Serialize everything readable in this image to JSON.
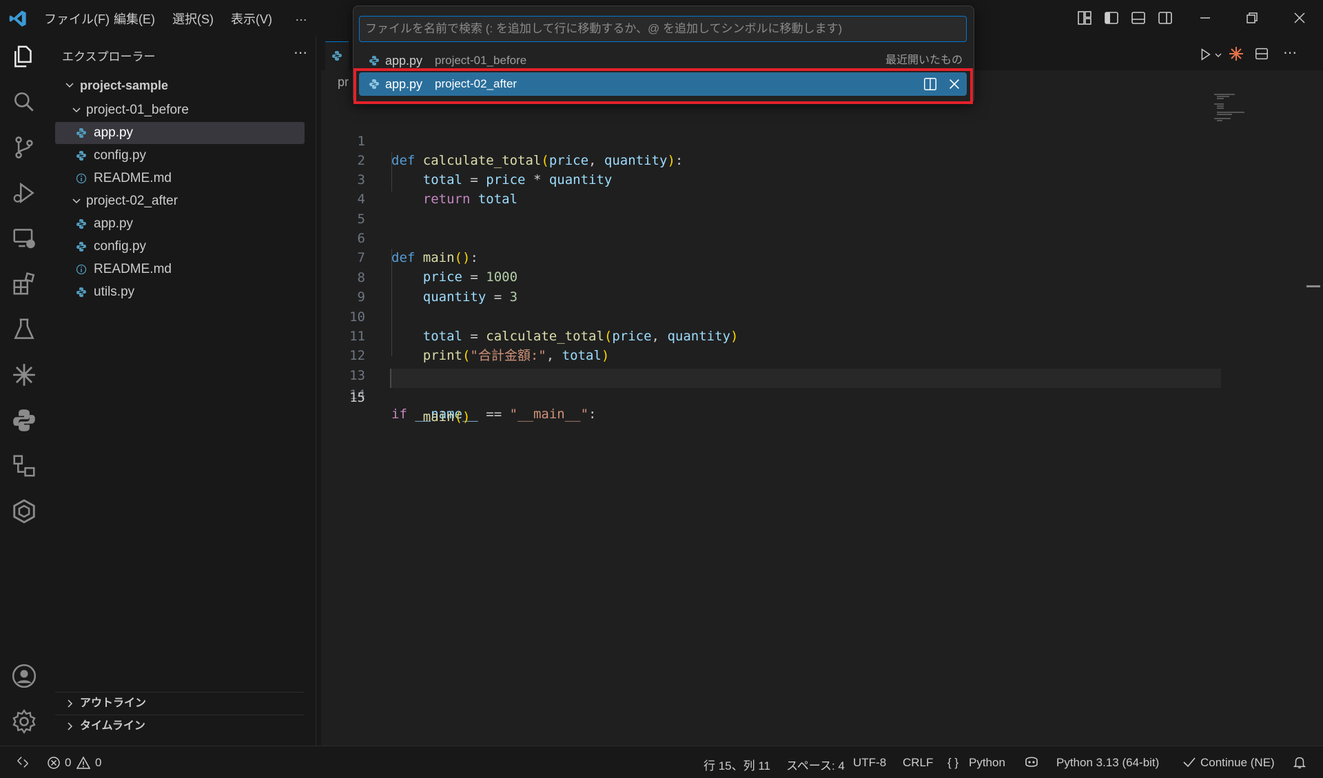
{
  "menu": [
    "ファイル(F)",
    "編集(E)",
    "選択(S)",
    "表示(V)",
    "…"
  ],
  "quickopen": {
    "placeholder": "ファイルを名前で検索 (: を追加して行に移動するか、@ を追加してシンボルに移動します)",
    "items": [
      {
        "name": "app.py",
        "desc": "project-01_before",
        "tag": "最近開いたもの"
      },
      {
        "name": "app.py",
        "desc": "project-02_after"
      }
    ]
  },
  "sidebar": {
    "title": "エクスプローラー",
    "root": "project-sample",
    "folder1": "project-01_before",
    "folder1_files": [
      "app.py",
      "config.py",
      "README.md"
    ],
    "folder2": "project-02_after",
    "folder2_files": [
      "app.py",
      "config.py",
      "README.md",
      "utils.py"
    ],
    "outline": "アウトライン",
    "timeline": "タイムライン"
  },
  "editor": {
    "breadcrumb": "pr",
    "current_line": 15,
    "line_numbers": [
      "1",
      "2",
      "3",
      "4",
      "5",
      "6",
      "7",
      "8",
      "9",
      "10",
      "11",
      "12",
      "13",
      "14",
      "15"
    ]
  },
  "status": {
    "errors": "0",
    "warnings": "0",
    "position": "行 15、列 11",
    "spaces": "スペース: 4",
    "encoding": "UTF-8",
    "eol": "CRLF",
    "language": "Python",
    "interpreter": "Python 3.13 (64-bit)",
    "continue": "Continue (NE)"
  },
  "colors": {
    "accent": "#0078d4",
    "selection": "#2a6f9c",
    "highlight_box": "#e3212a"
  }
}
